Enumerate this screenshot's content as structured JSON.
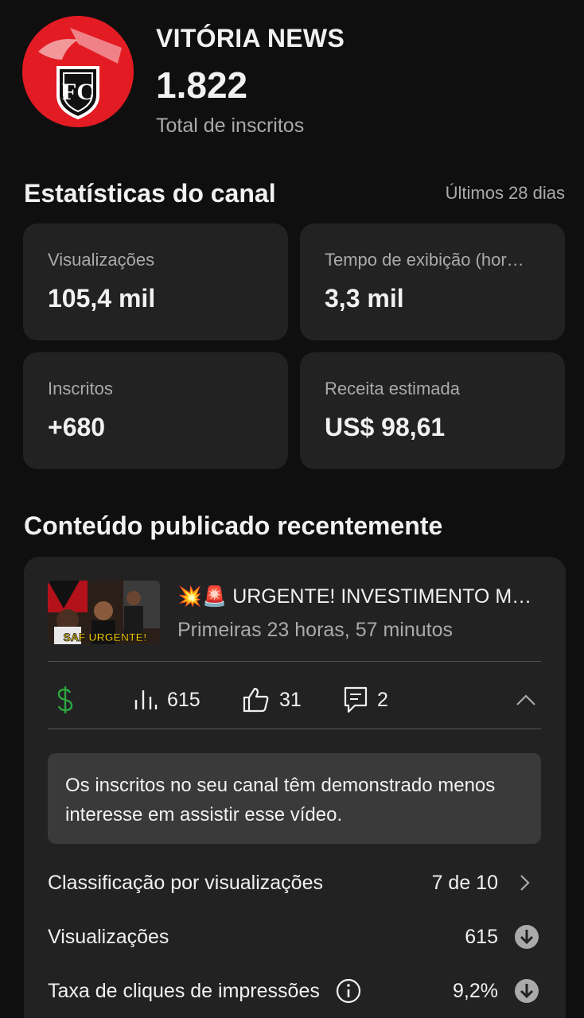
{
  "channel": {
    "name": "VITÓRIA NEWS",
    "subscribers": "1.822",
    "subscribers_label": "Total de inscritos"
  },
  "stats": {
    "title": "Estatísticas do canal",
    "period": "Últimos 28 dias",
    "cards": [
      {
        "label": "Visualizações",
        "value": "105,4 mil"
      },
      {
        "label": "Tempo de exibição (hor…",
        "value": "3,3 mil"
      },
      {
        "label": "Inscritos",
        "value": "+680"
      },
      {
        "label": "Receita estimada",
        "value": "US$ 98,61"
      }
    ]
  },
  "recent": {
    "title": "Conteúdo publicado recentemente",
    "video": {
      "title": "💥🚨 URGENTE!  INVESTIMENTO M…",
      "subtitle": "Primeiras 23 horas, 57 minutos",
      "thumbnail_text": "SAF URGENTE!",
      "views": "615",
      "likes": "31",
      "comments": "2",
      "monetization_icon": "dollar-icon",
      "monetization_color": "#2ba640"
    },
    "notice": "Os inscritos no seu canal têm demonstrado menos interesse em assistir esse vídeo.",
    "rows": [
      {
        "label": "Classificação por visualizações",
        "value": "7 de 10",
        "icon": "chevron-right-icon"
      },
      {
        "label": "Visualizações",
        "value": "615",
        "icon": "arrow-down-circle-icon"
      },
      {
        "label": "Taxa de cliques de impressões",
        "value": "9,2%",
        "icon": "arrow-down-circle-icon"
      }
    ]
  }
}
